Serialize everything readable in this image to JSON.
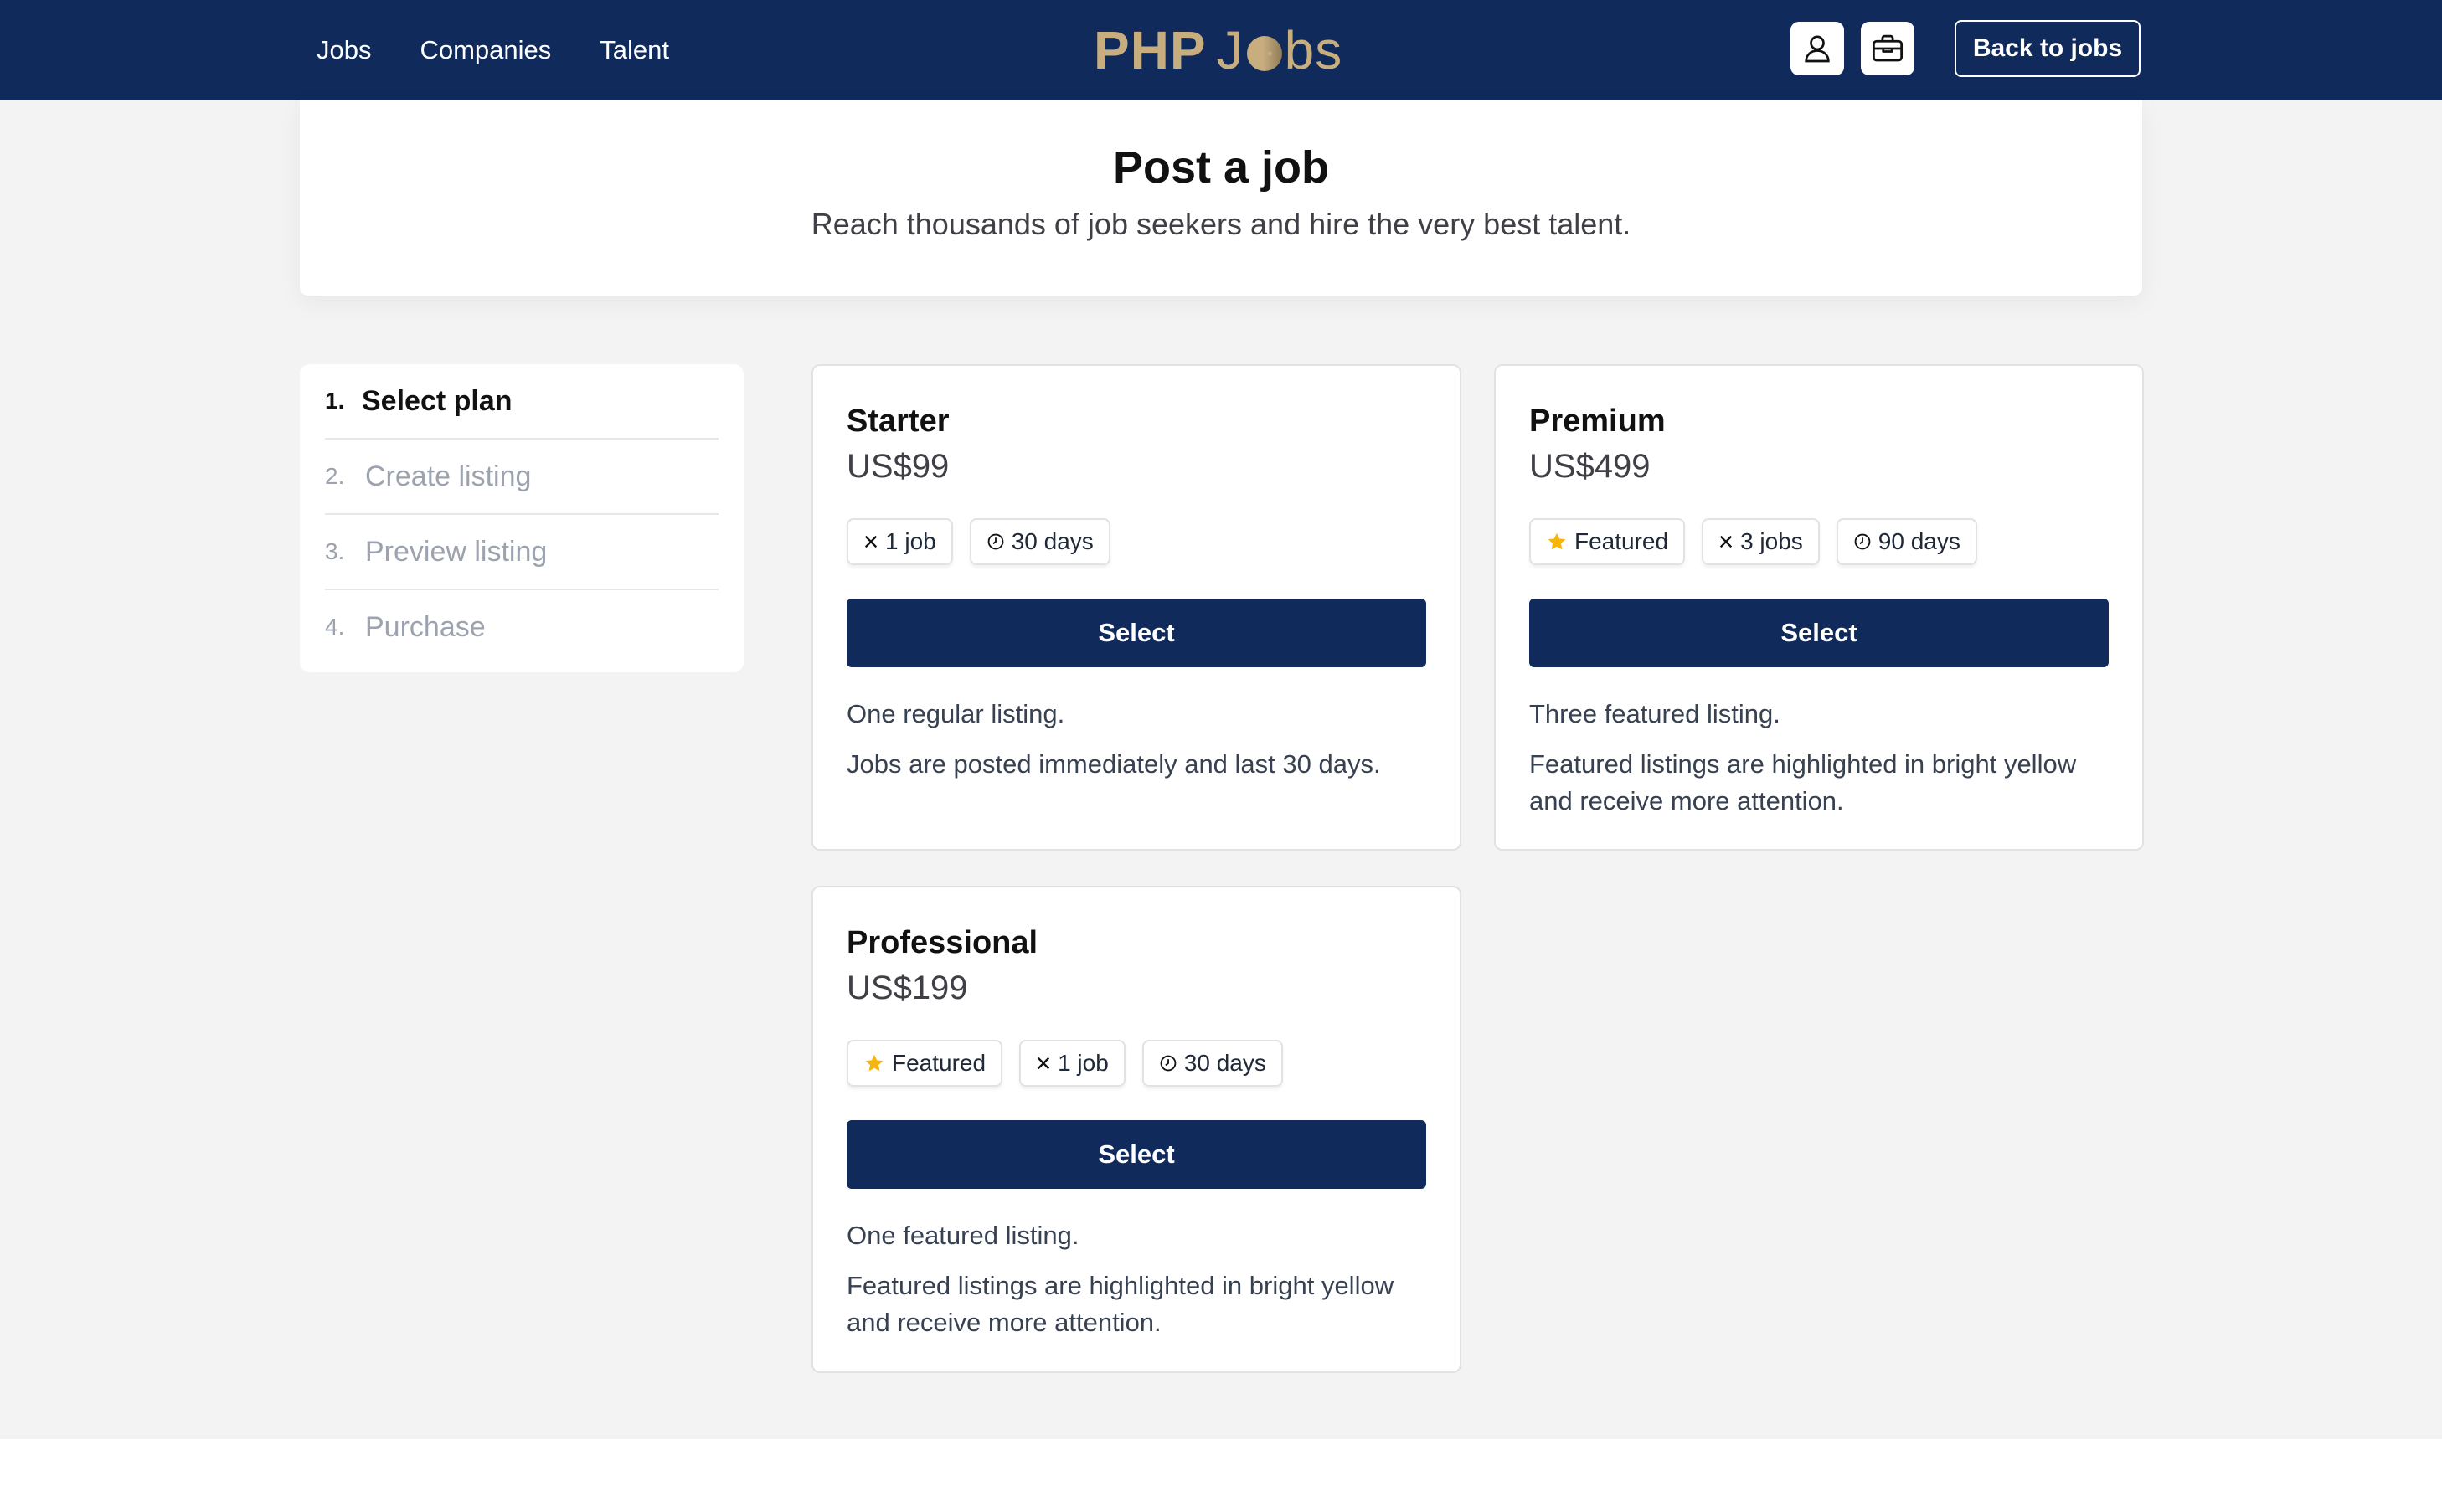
{
  "header": {
    "nav": [
      "Jobs",
      "Companies",
      "Talent"
    ],
    "logo_php": "PHP",
    "logo_jobs_start": "J",
    "logo_jobs_end": "bs",
    "back_label": "Back to jobs"
  },
  "hero": {
    "title": "Post a job",
    "subtitle": "Reach thousands of job seekers and hire the very best talent."
  },
  "steps": [
    {
      "num": "1.",
      "label": "Select plan",
      "active": true
    },
    {
      "num": "2.",
      "label": "Create listing",
      "active": false
    },
    {
      "num": "3.",
      "label": "Preview listing",
      "active": false
    },
    {
      "num": "4.",
      "label": "Purchase",
      "active": false
    }
  ],
  "plans": [
    {
      "name": "Starter",
      "price": "US$99",
      "tags": [
        {
          "icon": "times-icon",
          "label": "1 job"
        },
        {
          "icon": "clock-icon",
          "label": "30 days"
        }
      ],
      "select_label": "Select",
      "desc": [
        "One regular listing.",
        "Jobs are posted immediately and last 30 days."
      ]
    },
    {
      "name": "Premium",
      "price": "US$499",
      "tags": [
        {
          "icon": "star-icon",
          "label": "Featured"
        },
        {
          "icon": "times-icon",
          "label": "3 jobs"
        },
        {
          "icon": "clock-icon",
          "label": "90 days"
        }
      ],
      "select_label": "Select",
      "desc": [
        "Three featured listing.",
        "Featured listings are highlighted in bright yellow and receive more attention."
      ]
    },
    {
      "name": "Professional",
      "price": "US$199",
      "tags": [
        {
          "icon": "star-icon",
          "label": "Featured"
        },
        {
          "icon": "times-icon",
          "label": "1 job"
        },
        {
          "icon": "clock-icon",
          "label": "30 days"
        }
      ],
      "select_label": "Select",
      "desc": [
        "One featured listing.",
        "Featured listings are highlighted in bright yellow and receive more attention."
      ]
    }
  ],
  "colors": {
    "navy": "#102a5c",
    "gold": "#c8ad7f",
    "star": "#f5b50a"
  }
}
